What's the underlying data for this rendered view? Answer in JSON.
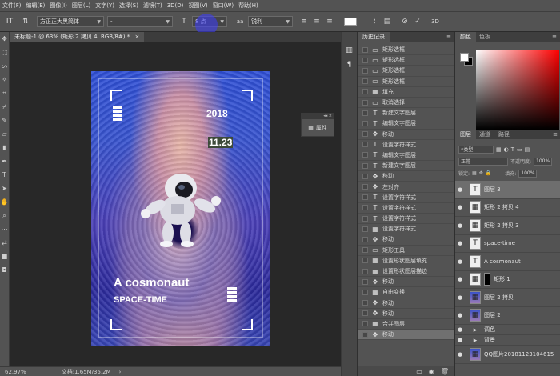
{
  "menu": [
    "文件(F)",
    "编辑(E)",
    "图像(I)",
    "图层(L)",
    "文字(Y)",
    "选择(S)",
    "滤镜(T)",
    "3D(D)",
    "视图(V)",
    "窗口(W)",
    "帮助(H)"
  ],
  "options": {
    "font_family": "方正正大黑简体",
    "font_style": "-",
    "size_icon": "T",
    "font_size": "8 点",
    "aa_icon": "aa",
    "aa_mode": "锐利",
    "color_swatch": "#ffffff"
  },
  "document": {
    "tab_title": "未标题-1 @ 63% (矩形 2 拷贝 4, RGB/8#) *",
    "close": "×"
  },
  "artwork": {
    "year": "2018",
    "date": "11.23",
    "headline": "A cosmonaut",
    "subline": "SPACE-TIME"
  },
  "properties_mini": {
    "label": "属性"
  },
  "status": {
    "zoom": "62.97%",
    "doc": "文档:1.65M/35.2M"
  },
  "history": {
    "tab": "历史记录",
    "items": [
      {
        "icon": "▭",
        "label": "矩形选框"
      },
      {
        "icon": "▭",
        "label": "矩形选框"
      },
      {
        "icon": "▭",
        "label": "矩形选框"
      },
      {
        "icon": "▭",
        "label": "矩形选框"
      },
      {
        "icon": "▦",
        "label": "填充"
      },
      {
        "icon": "▭",
        "label": "取消选择"
      },
      {
        "icon": "T",
        "label": "新建文字图层"
      },
      {
        "icon": "T",
        "label": "编辑文字图层"
      },
      {
        "icon": "✥",
        "label": "移动"
      },
      {
        "icon": "T",
        "label": "设置字符样式"
      },
      {
        "icon": "T",
        "label": "编辑文字图层"
      },
      {
        "icon": "T",
        "label": "新建文字图层"
      },
      {
        "icon": "✥",
        "label": "移动"
      },
      {
        "icon": "✥",
        "label": "左对齐"
      },
      {
        "icon": "T",
        "label": "设置字符样式"
      },
      {
        "icon": "T",
        "label": "设置字符样式"
      },
      {
        "icon": "T",
        "label": "设置字符样式"
      },
      {
        "icon": "▦",
        "label": "设置字符样式"
      },
      {
        "icon": "✥",
        "label": "移动"
      },
      {
        "icon": "▭",
        "label": "矩形工具"
      },
      {
        "icon": "▦",
        "label": "设置形状图层填充"
      },
      {
        "icon": "▦",
        "label": "设置形状图层描边"
      },
      {
        "icon": "✥",
        "label": "移动"
      },
      {
        "icon": "▦",
        "label": "自由变换"
      },
      {
        "icon": "✥",
        "label": "移动"
      },
      {
        "icon": "✥",
        "label": "移动"
      },
      {
        "icon": "▦",
        "label": "合并图层"
      },
      {
        "icon": "✥",
        "label": "移动"
      }
    ]
  },
  "color_panel": {
    "tab": "颜色",
    "tab2": "色板"
  },
  "layers_panel": {
    "tab": "图层",
    "tab2": "通道",
    "tab3": "路径",
    "kind": "类型",
    "blend": "正常",
    "opacity_label": "不透明度:",
    "opacity": "100%",
    "lock_label": "锁定:",
    "fill_label": "填充:",
    "fill": "100%",
    "layers": [
      {
        "thumb": "T",
        "name": "图层 3",
        "selected": true
      },
      {
        "thumb": "▦",
        "name": "矩形 2 拷贝 4"
      },
      {
        "thumb": "▦",
        "name": "矩形 2 拷贝 3"
      },
      {
        "thumb": "T",
        "name": "space-time"
      },
      {
        "thumb": "T",
        "name": "A   cosmonaut"
      },
      {
        "thumb": "▦",
        "name": "矩形 1",
        "mask": true
      },
      {
        "thumb": "▦",
        "name": "图层 2 拷贝",
        "photo": true
      },
      {
        "thumb": "▦",
        "name": "图层 2",
        "photo": true
      },
      {
        "thumb": "▸",
        "name": "调色",
        "group": true
      },
      {
        "thumb": "▸",
        "name": "背景",
        "group": true
      },
      {
        "thumb": "▦",
        "name": "QQ图片20181123104615",
        "photo": true
      }
    ]
  }
}
